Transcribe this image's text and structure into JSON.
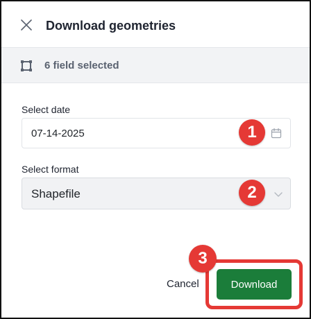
{
  "dialog": {
    "title": "Download geometries",
    "close_icon": "close-icon"
  },
  "selection": {
    "icon": "field-boundary-icon",
    "text": "6 field selected"
  },
  "form": {
    "date_label": "Select date",
    "date_value": "07-14-2025",
    "date_icon": "calendar-icon",
    "format_label": "Select format",
    "format_value": "Shapefile",
    "format_icon": "chevron-down-icon"
  },
  "callouts": [
    "1",
    "2",
    "3"
  ],
  "footer": {
    "cancel_label": "Cancel",
    "download_label": "Download"
  },
  "colors": {
    "primary": "#1b7d3a",
    "callout": "#e53935",
    "selection_bar": "#f2f3f5",
    "select_bg": "#f1f2f4"
  }
}
